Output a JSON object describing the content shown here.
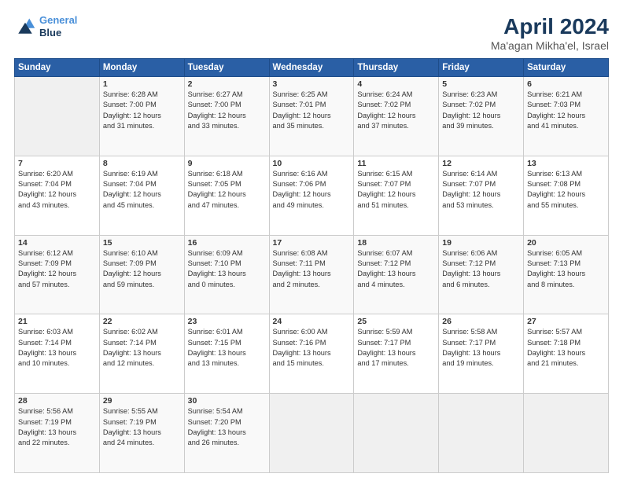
{
  "header": {
    "logo_line1": "General",
    "logo_line2": "Blue",
    "month": "April 2024",
    "location": "Ma'agan Mikha'el, Israel"
  },
  "weekdays": [
    "Sunday",
    "Monday",
    "Tuesday",
    "Wednesday",
    "Thursday",
    "Friday",
    "Saturday"
  ],
  "weeks": [
    [
      {
        "date": "",
        "info": ""
      },
      {
        "date": "1",
        "info": "Sunrise: 6:28 AM\nSunset: 7:00 PM\nDaylight: 12 hours\nand 31 minutes."
      },
      {
        "date": "2",
        "info": "Sunrise: 6:27 AM\nSunset: 7:00 PM\nDaylight: 12 hours\nand 33 minutes."
      },
      {
        "date": "3",
        "info": "Sunrise: 6:25 AM\nSunset: 7:01 PM\nDaylight: 12 hours\nand 35 minutes."
      },
      {
        "date": "4",
        "info": "Sunrise: 6:24 AM\nSunset: 7:02 PM\nDaylight: 12 hours\nand 37 minutes."
      },
      {
        "date": "5",
        "info": "Sunrise: 6:23 AM\nSunset: 7:02 PM\nDaylight: 12 hours\nand 39 minutes."
      },
      {
        "date": "6",
        "info": "Sunrise: 6:21 AM\nSunset: 7:03 PM\nDaylight: 12 hours\nand 41 minutes."
      }
    ],
    [
      {
        "date": "7",
        "info": "Sunrise: 6:20 AM\nSunset: 7:04 PM\nDaylight: 12 hours\nand 43 minutes."
      },
      {
        "date": "8",
        "info": "Sunrise: 6:19 AM\nSunset: 7:04 PM\nDaylight: 12 hours\nand 45 minutes."
      },
      {
        "date": "9",
        "info": "Sunrise: 6:18 AM\nSunset: 7:05 PM\nDaylight: 12 hours\nand 47 minutes."
      },
      {
        "date": "10",
        "info": "Sunrise: 6:16 AM\nSunset: 7:06 PM\nDaylight: 12 hours\nand 49 minutes."
      },
      {
        "date": "11",
        "info": "Sunrise: 6:15 AM\nSunset: 7:07 PM\nDaylight: 12 hours\nand 51 minutes."
      },
      {
        "date": "12",
        "info": "Sunrise: 6:14 AM\nSunset: 7:07 PM\nDaylight: 12 hours\nand 53 minutes."
      },
      {
        "date": "13",
        "info": "Sunrise: 6:13 AM\nSunset: 7:08 PM\nDaylight: 12 hours\nand 55 minutes."
      }
    ],
    [
      {
        "date": "14",
        "info": "Sunrise: 6:12 AM\nSunset: 7:09 PM\nDaylight: 12 hours\nand 57 minutes."
      },
      {
        "date": "15",
        "info": "Sunrise: 6:10 AM\nSunset: 7:09 PM\nDaylight: 12 hours\nand 59 minutes."
      },
      {
        "date": "16",
        "info": "Sunrise: 6:09 AM\nSunset: 7:10 PM\nDaylight: 13 hours\nand 0 minutes."
      },
      {
        "date": "17",
        "info": "Sunrise: 6:08 AM\nSunset: 7:11 PM\nDaylight: 13 hours\nand 2 minutes."
      },
      {
        "date": "18",
        "info": "Sunrise: 6:07 AM\nSunset: 7:12 PM\nDaylight: 13 hours\nand 4 minutes."
      },
      {
        "date": "19",
        "info": "Sunrise: 6:06 AM\nSunset: 7:12 PM\nDaylight: 13 hours\nand 6 minutes."
      },
      {
        "date": "20",
        "info": "Sunrise: 6:05 AM\nSunset: 7:13 PM\nDaylight: 13 hours\nand 8 minutes."
      }
    ],
    [
      {
        "date": "21",
        "info": "Sunrise: 6:03 AM\nSunset: 7:14 PM\nDaylight: 13 hours\nand 10 minutes."
      },
      {
        "date": "22",
        "info": "Sunrise: 6:02 AM\nSunset: 7:14 PM\nDaylight: 13 hours\nand 12 minutes."
      },
      {
        "date": "23",
        "info": "Sunrise: 6:01 AM\nSunset: 7:15 PM\nDaylight: 13 hours\nand 13 minutes."
      },
      {
        "date": "24",
        "info": "Sunrise: 6:00 AM\nSunset: 7:16 PM\nDaylight: 13 hours\nand 15 minutes."
      },
      {
        "date": "25",
        "info": "Sunrise: 5:59 AM\nSunset: 7:17 PM\nDaylight: 13 hours\nand 17 minutes."
      },
      {
        "date": "26",
        "info": "Sunrise: 5:58 AM\nSunset: 7:17 PM\nDaylight: 13 hours\nand 19 minutes."
      },
      {
        "date": "27",
        "info": "Sunrise: 5:57 AM\nSunset: 7:18 PM\nDaylight: 13 hours\nand 21 minutes."
      }
    ],
    [
      {
        "date": "28",
        "info": "Sunrise: 5:56 AM\nSunset: 7:19 PM\nDaylight: 13 hours\nand 22 minutes."
      },
      {
        "date": "29",
        "info": "Sunrise: 5:55 AM\nSunset: 7:19 PM\nDaylight: 13 hours\nand 24 minutes."
      },
      {
        "date": "30",
        "info": "Sunrise: 5:54 AM\nSunset: 7:20 PM\nDaylight: 13 hours\nand 26 minutes."
      },
      {
        "date": "",
        "info": ""
      },
      {
        "date": "",
        "info": ""
      },
      {
        "date": "",
        "info": ""
      },
      {
        "date": "",
        "info": ""
      }
    ]
  ]
}
